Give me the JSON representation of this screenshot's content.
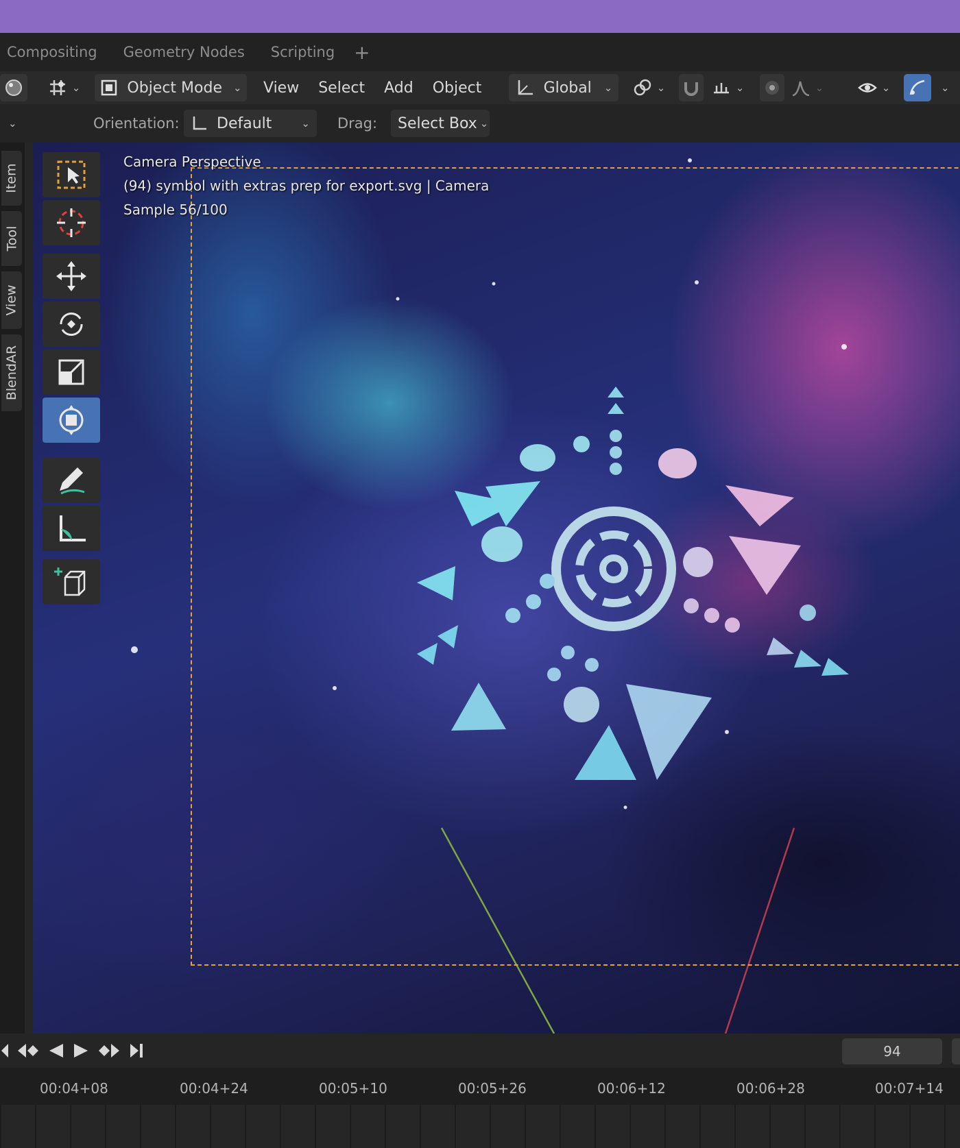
{
  "workspace_tabs": [
    "Compositing",
    "Geometry Nodes",
    "Scripting"
  ],
  "workspace_add": "+",
  "header": {
    "mode_label": "Object Mode",
    "menus": [
      "View",
      "Select",
      "Add",
      "Object"
    ],
    "transform_orientation": "Global"
  },
  "tool_settings": {
    "orientation_label": "Orientation:",
    "orientation_value": "Default",
    "drag_label": "Drag:",
    "drag_value": "Select Box"
  },
  "side_tabs": [
    "Item",
    "Tool",
    "View",
    "BlendAR"
  ],
  "viewport": {
    "line1": "Camera Perspective",
    "line2": "(94) symbol with extras prep for export.svg | Camera",
    "line3": "Sample 56/100"
  },
  "toolbar_icons": [
    "select-box-icon",
    "cursor-icon",
    "move-icon",
    "rotate-icon",
    "scale-icon",
    "transform-icon",
    "annotate-icon",
    "measure-icon",
    "add-cube-icon"
  ],
  "timeline": {
    "current_frame": "94",
    "ticks": [
      "00:04+08",
      "00:04+24",
      "00:05+10",
      "00:05+26",
      "00:06+12",
      "00:06+28",
      "00:07+14"
    ]
  },
  "colors": {
    "top_bar": "#8a6ac3",
    "accent_active": "#4772b3",
    "camera_frame": "#e6a33a"
  }
}
